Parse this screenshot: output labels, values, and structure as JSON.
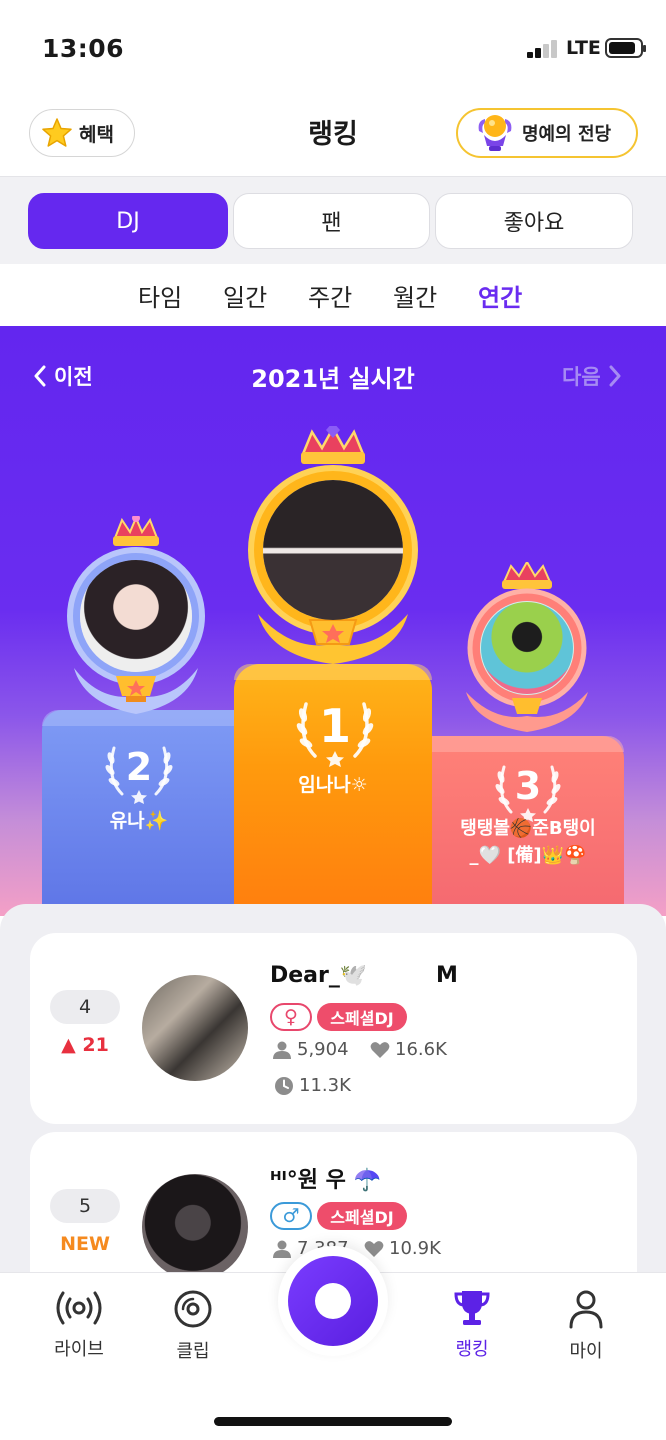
{
  "status": {
    "time": "13:06",
    "network": "LTE"
  },
  "header": {
    "benefit_label": "혜택",
    "title": "랭킹",
    "hall_label": "명예의 전당"
  },
  "segments": [
    {
      "label": "DJ",
      "active": true
    },
    {
      "label": "팬",
      "active": false
    },
    {
      "label": "좋아요",
      "active": false
    }
  ],
  "period_tabs": [
    {
      "label": "타임",
      "active": false
    },
    {
      "label": "일간",
      "active": false
    },
    {
      "label": "주간",
      "active": false
    },
    {
      "label": "월간",
      "active": false
    },
    {
      "label": "연간",
      "active": true
    }
  ],
  "hero": {
    "prev_label": "이전",
    "title": "2021년 실시간",
    "next_label": "다음",
    "podium": [
      {
        "rank": "1",
        "name": "임나나☼"
      },
      {
        "rank": "2",
        "name": "유나✨"
      },
      {
        "rank": "3",
        "name_line1": "탱탱볼🏀준B탱이",
        "name_line2": "_🤍 [備]👑🍄"
      }
    ]
  },
  "list": [
    {
      "rank": "4",
      "change": "▲ 21",
      "change_type": "up",
      "name": "Dear_🕊️",
      "name_suffix": "M",
      "gender_symbol": "♀",
      "badge": "스페셜DJ",
      "listeners": "5,904",
      "likes": "16.6K",
      "time": "11.3K"
    },
    {
      "rank": "5",
      "change": "NEW",
      "change_type": "new",
      "name": "ᴴᴵ°원 우 ☂️",
      "gender_symbol": "♂",
      "badge": "스페셜DJ",
      "listeners": "7,387",
      "likes": "10.9K"
    }
  ],
  "nav": [
    {
      "label": "라이브",
      "icon": "live-icon"
    },
    {
      "label": "클립",
      "icon": "clip-icon"
    },
    {
      "label": "랭킹",
      "icon": "trophy-icon",
      "active": true
    },
    {
      "label": "마이",
      "icon": "profile-icon"
    }
  ],
  "colors": {
    "accent": "#6528ef",
    "gold": "#ff9a0d",
    "silver_blue": "#6f86ee",
    "bronze": "#f46870",
    "badge_red": "#ee4d6b",
    "up_red": "#e8303f",
    "new_orange": "#f58a1f"
  }
}
